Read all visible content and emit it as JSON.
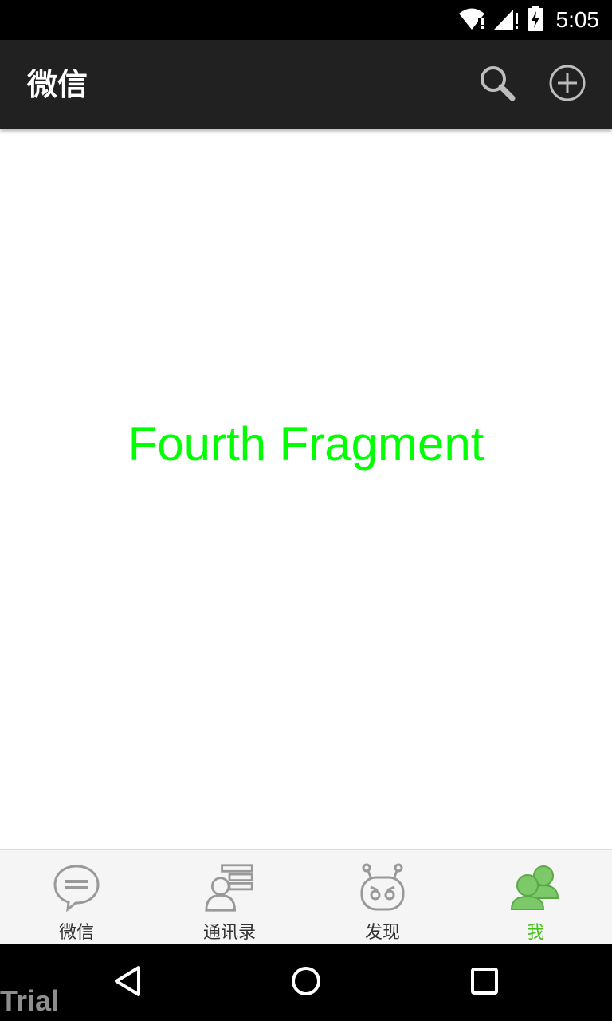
{
  "status_bar": {
    "time": "5:05",
    "icons": [
      "wifi-alert-icon",
      "signal-alert-icon",
      "battery-charging-icon"
    ]
  },
  "action_bar": {
    "title": "微信",
    "search_icon": "search-icon",
    "add_icon": "add-circle-icon"
  },
  "content": {
    "text": "Fourth Fragment",
    "text_color": "#00ff00"
  },
  "tabs": [
    {
      "label": "微信",
      "icon": "chat-bubble-icon",
      "active": false
    },
    {
      "label": "通讯录",
      "icon": "contacts-icon",
      "active": false
    },
    {
      "label": "发现",
      "icon": "discover-icon",
      "active": false
    },
    {
      "label": "我",
      "icon": "me-icon",
      "active": true
    }
  ],
  "colors": {
    "action_bar_bg": "#212121",
    "tab_active": "#45c01a",
    "tab_inactive": "#333333"
  },
  "nav_bar": {
    "icons": [
      "back-icon",
      "home-icon",
      "recent-apps-icon"
    ],
    "watermark": "Trial"
  }
}
